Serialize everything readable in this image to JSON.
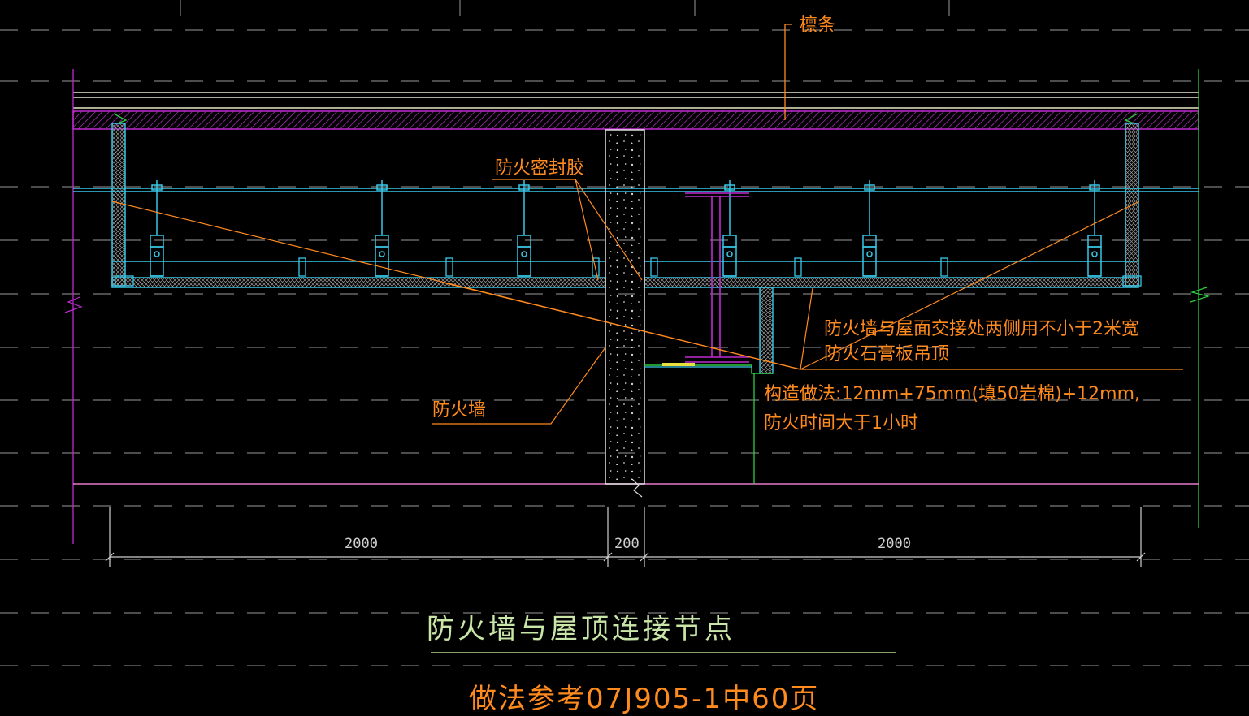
{
  "labels": {
    "purlin": "檩条",
    "sealant": "防火密封胶",
    "note_line1": "防火墙与屋面交接处两侧用不小于2米宽",
    "note_line2": "防火石膏板吊顶",
    "note_line3": "构造做法:12mm+75mm(填50岩棉)+12mm,",
    "note_line4": "防火时间大于1小时",
    "firewall": "防火墙"
  },
  "dimensions": {
    "left": "2000",
    "middle": "200",
    "right": "2000"
  },
  "title": "防火墙与屋顶连接节点",
  "reference": "做法参考07J905-1中60页",
  "colors": {
    "background": "#000000",
    "annotation": "#ff8a1e",
    "title": "#c9e6a8",
    "structure_cyan": "#39c8e8",
    "insulation_magenta": "#c02ad0",
    "grid_dash": "#9a9a9a",
    "dimension": "#d0d0d0"
  }
}
